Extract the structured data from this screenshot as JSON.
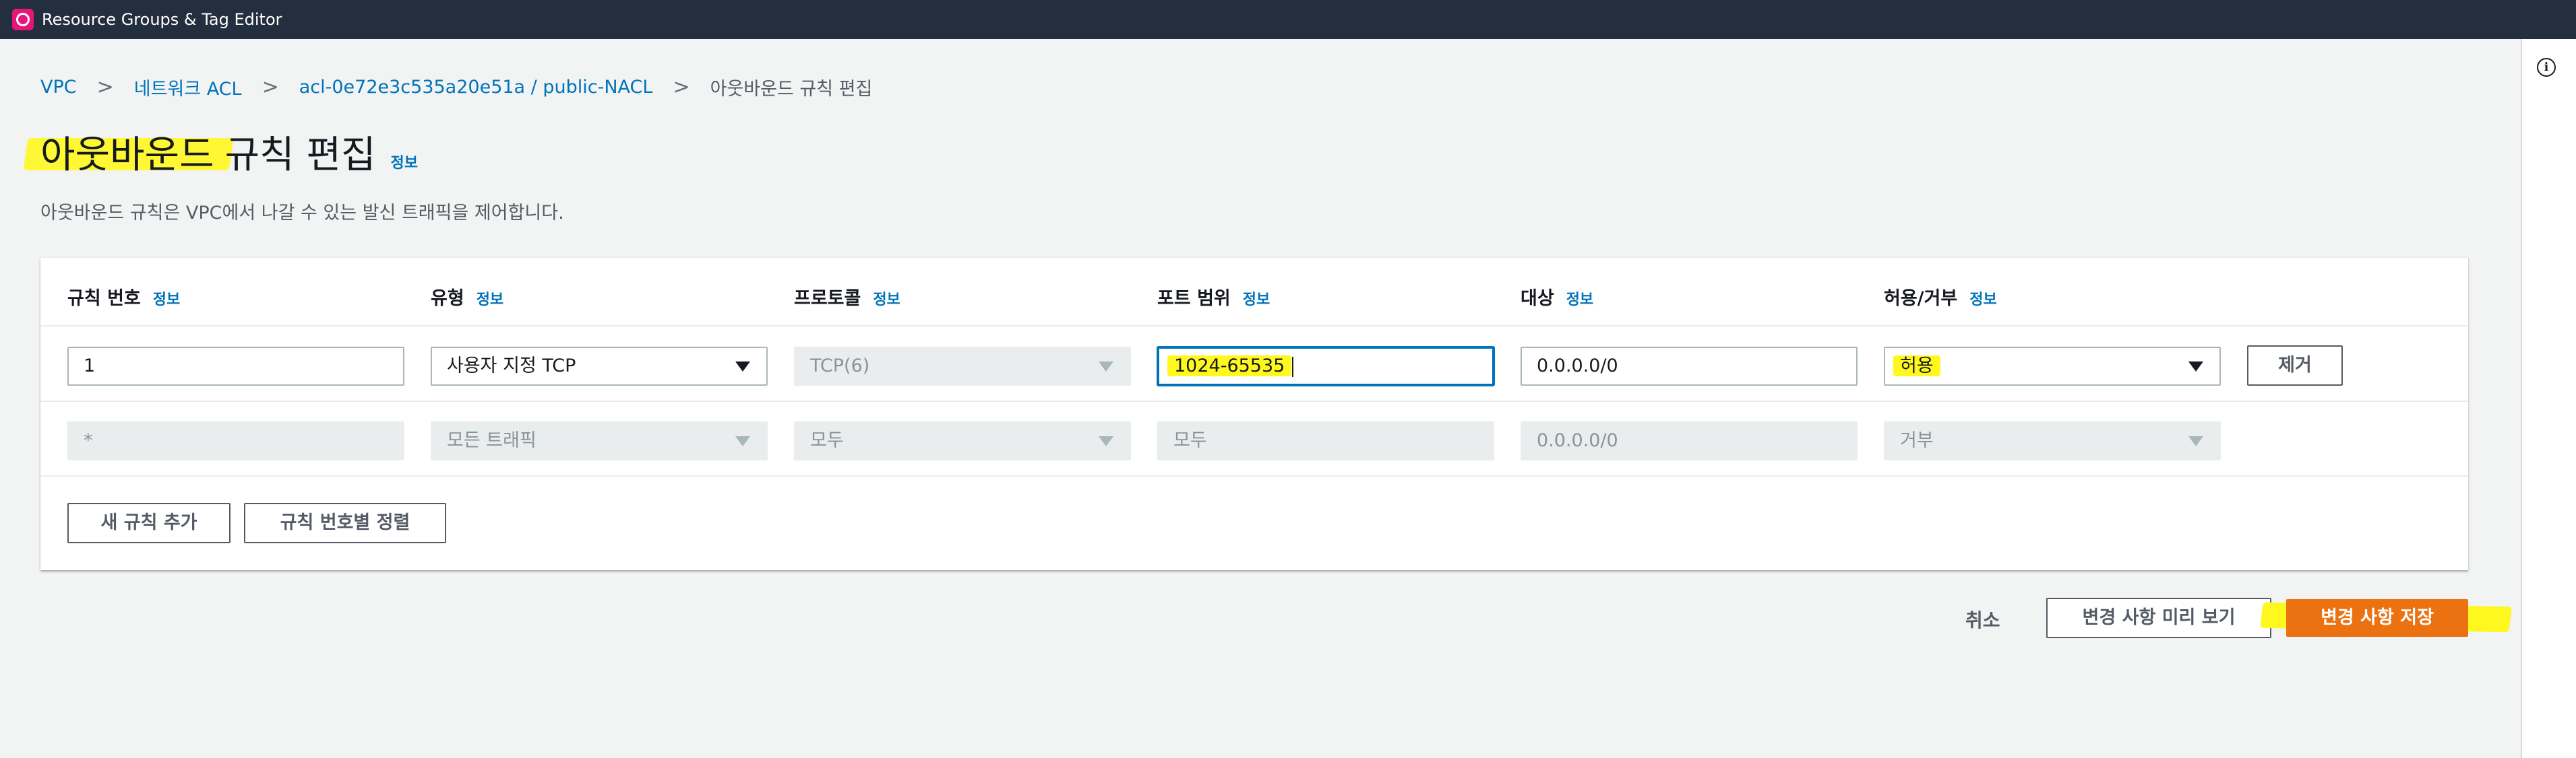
{
  "app": {
    "title": "Resource Groups & Tag Editor",
    "icon": "resource-groups-icon"
  },
  "breadcrumb": {
    "items": [
      "VPC",
      "네트워크 ACL",
      "acl-0e72e3c535a20e51a / public-NACL"
    ],
    "current": "아웃바운드 규칙 편집",
    "separator": ">"
  },
  "page": {
    "title_highlighted": "아웃바운드",
    "title_rest": "규칙 편집",
    "info": "정보",
    "description": "아웃바운드 규칙은 VPC에서 나갈 수 있는 발신 트래픽을 제어합니다."
  },
  "table": {
    "columns": [
      {
        "label": "규칙 번호",
        "info": "정보"
      },
      {
        "label": "유형",
        "info": "정보"
      },
      {
        "label": "프로토콜",
        "info": "정보"
      },
      {
        "label": "포트 범위",
        "info": "정보"
      },
      {
        "label": "대상",
        "info": "정보"
      },
      {
        "label": "허용/거부",
        "info": "정보"
      }
    ],
    "rows": [
      {
        "rule_number": "1",
        "type": "사용자 지정 TCP",
        "protocol": "TCP(6)",
        "port_range": "1024-65535",
        "destination": "0.0.0.0/0",
        "action": "허용",
        "remove": "제거"
      },
      {
        "rule_number": "*",
        "type": "모든 트래픽",
        "protocol": "모두",
        "port_range": "모두",
        "destination": "0.0.0.0/0",
        "action": "거부"
      }
    ],
    "add_rule": "새 규칙 추가",
    "sort_rules": "규칙 번호별 정렬"
  },
  "footer": {
    "cancel": "취소",
    "preview": "변경 사항 미리 보기",
    "save": "변경 사항 저장"
  },
  "colors": {
    "header_bg": "#232f3e",
    "link": "#0073bb",
    "primary": "#ec7211",
    "highlight": "#fff81f",
    "focus": "#0073bb"
  }
}
